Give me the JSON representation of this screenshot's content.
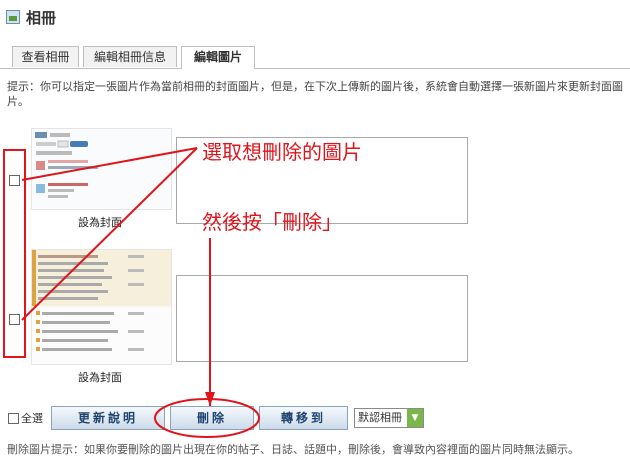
{
  "header": {
    "title": "相冊",
    "icon": "album-icon"
  },
  "tabs": [
    {
      "label": "查看相冊"
    },
    {
      "label": "編輯相冊信息"
    },
    {
      "label": "編輯圖片",
      "active": true
    }
  ],
  "tip": "提示：你可以指定一張圖片作為當前相冊的封面圖片，但是，在下次上傳新的圖片後，系統會自動選擇一張新圖片來更新封面圖片。",
  "photos": [
    {
      "set_cover_label": "設為封面",
      "description": ""
    },
    {
      "set_cover_label": "設為封面",
      "description": ""
    }
  ],
  "actions": {
    "select_all_label": "全選",
    "update_label": "更新說明",
    "delete_label": "刪除",
    "move_label": "轉移到",
    "album_select_value": "默認相冊"
  },
  "bottom_tip": "刪除圖片提示：如果你要刪除的圖片出現在你的帖子、日誌、話題中，刪除後，會導致內容裡面的圖片同時無法顯示。",
  "annotations": {
    "select_note": "選取想刪除的圖片",
    "delete_note": "然後按「刪除」"
  },
  "colors": {
    "annotation": "#e0141b",
    "button_text": "#1f4470",
    "select_arrow": "#7ab648"
  }
}
